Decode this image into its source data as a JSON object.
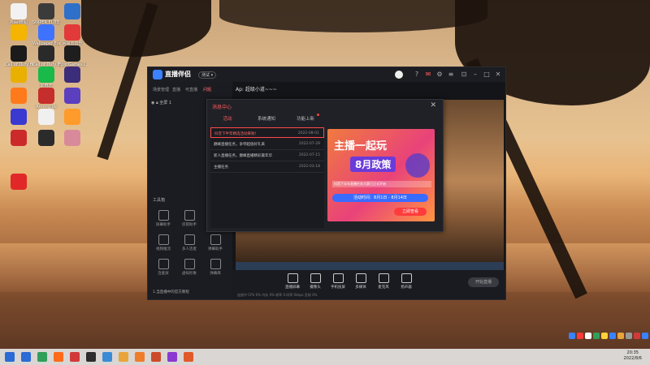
{
  "desktop": {
    "icons": [
      {
        "label": "Pixel修图",
        "color": "#f2f2f2"
      },
      {
        "label": "SNIPER ELITE 5",
        "color": "#3b3b3b"
      },
      {
        "label": "",
        "color": "#2e70c9"
      },
      {
        "label": "",
        "color": "#f5b400"
      },
      {
        "label": "Wallpaper Engine",
        "color": "#3e73ff"
      },
      {
        "label": "网易云音乐",
        "color": "#e23a3a"
      },
      {
        "label": "Call of Duty Black Ops",
        "color": "#1b1b1b"
      },
      {
        "label": "Call of Duty Modern W..",
        "color": "#2a2a2a"
      },
      {
        "label": "Epic Games Launcher",
        "color": "#1e1e1e"
      },
      {
        "label": "",
        "color": "#e9b000"
      },
      {
        "label": "爱奇艺",
        "color": "#19b94a"
      },
      {
        "label": "",
        "color": "#3c2d7a"
      },
      {
        "label": "",
        "color": "#ff7a1a"
      },
      {
        "label": "Among Us",
        "color": "#c62d2d"
      },
      {
        "label": "",
        "color": "#5b3fbf"
      },
      {
        "label": "",
        "color": "#3a3ad1"
      },
      {
        "label": "",
        "color": "#f0f0f0"
      },
      {
        "label": "",
        "color": "#ff9b2a"
      },
      {
        "label": "",
        "color": "#cc2a2a"
      },
      {
        "label": "",
        "color": "#2b2b2b"
      },
      {
        "label": "",
        "color": "#d98a9a"
      },
      {
        "label": "",
        "color": "#e12727"
      }
    ]
  },
  "app": {
    "title": "直播伴侣",
    "badge": "测试 ▾",
    "left_tabs": [
      "场景管理",
      "直播",
      "可直播",
      "问题"
    ],
    "scene_item": "全屏 1",
    "scene_tabs": "Ap: 超级小道~~~",
    "tools_title": "工具箱",
    "tools": [
      {
        "label": "屏幕助手"
      },
      {
        "label": "房管助手"
      },
      {
        "label": "直播助手"
      },
      {
        "label": "视频推流"
      },
      {
        "label": "多人连麦"
      },
      {
        "label": "弹幕助手"
      },
      {
        "label": "连麦屏"
      },
      {
        "label": "虚拟形象"
      },
      {
        "label": "弹幕库"
      }
    ],
    "left_footer": "1.当直播中的官方教程",
    "bottom_buttons": [
      {
        "label": "直播屏幕"
      },
      {
        "label": "摄像头"
      },
      {
        "label": "手机投屏"
      },
      {
        "label": "多媒体"
      },
      {
        "label": "麦克风"
      },
      {
        "label": "扬声器"
      }
    ],
    "start_live": "开始直播",
    "status_bar": "连接中 CPU 0%  内存 0%  帧率 0  码率 0kbps  丢帧 0%"
  },
  "dialog": {
    "title": "消息中心",
    "tabs": [
      "活动",
      "系统通知",
      "功能上新"
    ],
    "active_tab": 0,
    "items": [
      {
        "title": "抖音下半年精选活动来啦！",
        "date": "2022-08-01",
        "selected": true
      },
      {
        "title": "巅峰直播任务，争夺超值好礼来",
        "date": "2022-07-29"
      },
      {
        "title": "新人直播任务，巅峰直播精彩嘉年华",
        "date": "2022-07-15"
      },
      {
        "title": "主播任务",
        "date": "2022-03-18"
      }
    ],
    "banner": {
      "headline": "主播一起玩",
      "subhead": "8月政策",
      "note": "抖音下半年直播任务大赛已正式开始",
      "time": "活动时间：8月1日 - 8月14日",
      "cta": "立即查看"
    }
  },
  "taskbar": {
    "icons": [
      "#2a6bd6",
      "#2f9f5a",
      "#ff6b1a",
      "#d23a3a",
      "#2d2d2d",
      "#3a8bd6",
      "#e9a53a",
      "#f07c2a",
      "#cc4a2a",
      "#8a3ad1",
      "#e25a2a"
    ],
    "time": "20:35",
    "date": "2022/8/6"
  }
}
